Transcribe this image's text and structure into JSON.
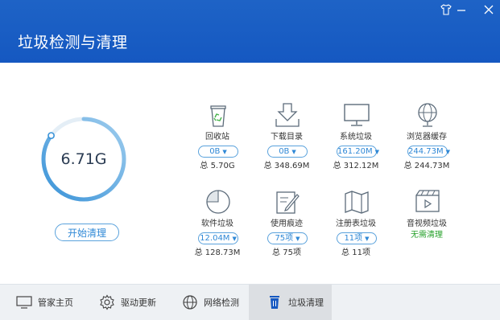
{
  "window": {
    "title": "垃圾检测与清理",
    "controls": [
      "shirt-icon",
      "minimize-icon",
      "close-icon"
    ]
  },
  "summary": {
    "total_size": "6.71G",
    "ring_fill": 0.85,
    "start_button": "开始清理"
  },
  "items": [
    {
      "name": "回收站",
      "icon": "recycle-bin-icon",
      "selected": "0B",
      "total": "总 5.70G"
    },
    {
      "name": "下载目录",
      "icon": "download-folder-icon",
      "selected": "0B",
      "total": "总 348.69M"
    },
    {
      "name": "系统垃圾",
      "icon": "monitor-icon",
      "selected": "161.20M",
      "total": "总 312.12M"
    },
    {
      "name": "浏览器缓存",
      "icon": "globe-icon",
      "selected": "244.73M",
      "total": "总 244.73M"
    },
    {
      "name": "软件垃圾",
      "icon": "pie-chart-icon",
      "selected": "12.04M",
      "total": "总 128.73M"
    },
    {
      "name": "使用痕迹",
      "icon": "edit-document-icon",
      "selected": "75项",
      "total": "总 75项"
    },
    {
      "name": "注册表垃圾",
      "icon": "map-icon",
      "selected": "11项",
      "total": "总 11项"
    },
    {
      "name": "音视频垃圾",
      "icon": "video-icon",
      "status": "无需清理",
      "status_color": "#27a12b"
    }
  ],
  "footer": {
    "tabs": [
      {
        "label": "管家主页",
        "icon": "monitor-home-icon"
      },
      {
        "label": "驱动更新",
        "icon": "gear-icon"
      },
      {
        "label": "网络检测",
        "icon": "globe-icon"
      },
      {
        "label": "垃圾清理",
        "icon": "trash-icon",
        "active": true
      }
    ]
  },
  "colors": {
    "header": "#1558c1",
    "accent": "#2f88d6",
    "success": "#27a12b"
  }
}
